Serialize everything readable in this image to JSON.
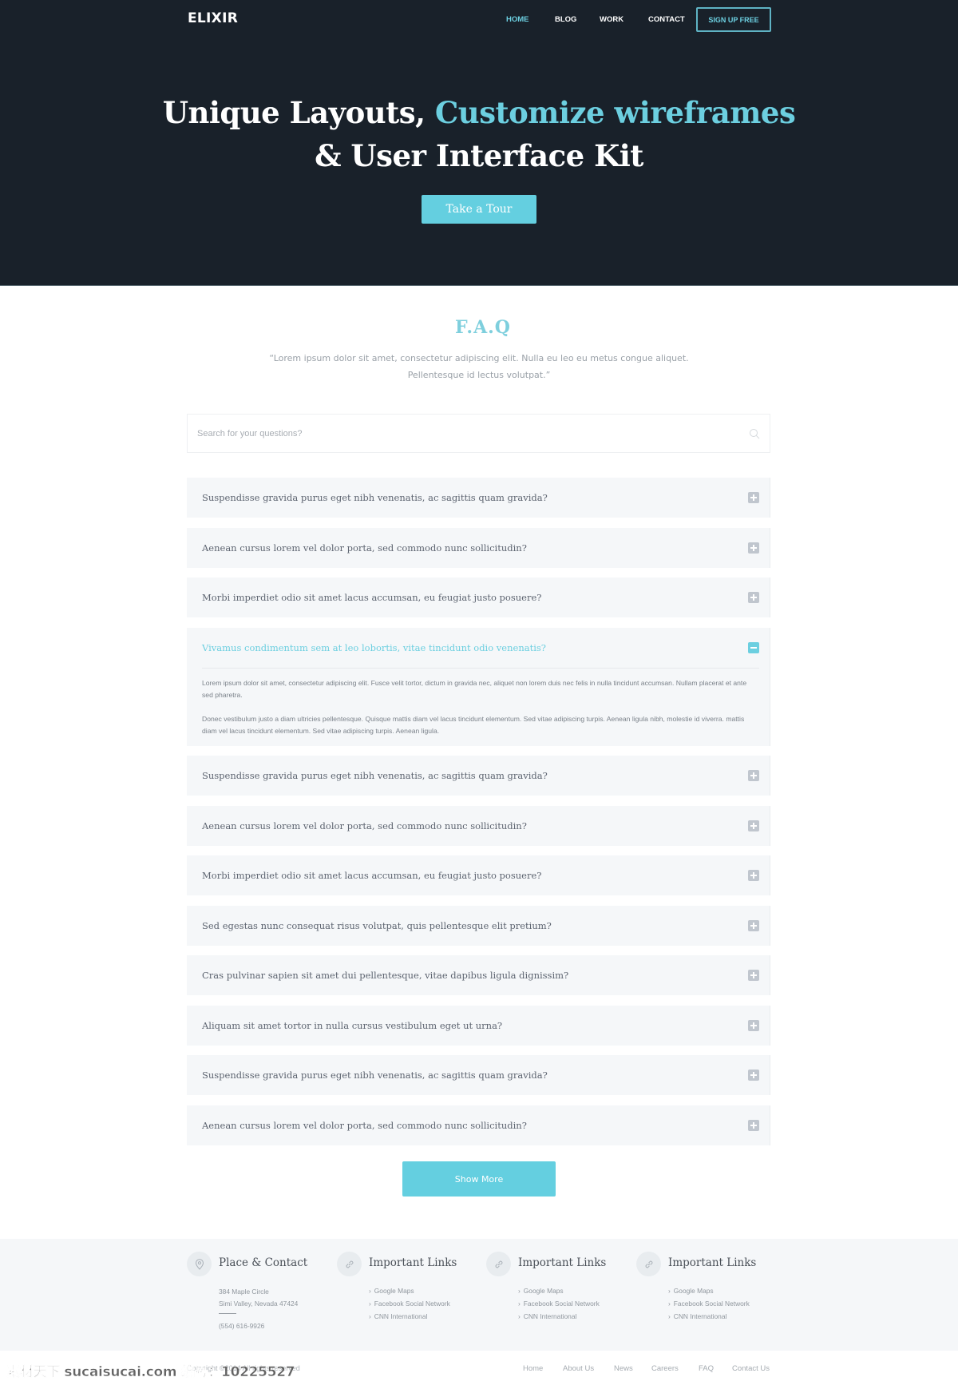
{
  "header": {
    "logo": "ELIXIR",
    "nav": [
      {
        "label": "HOME",
        "active": true
      },
      {
        "label": "BLOG",
        "active": false
      },
      {
        "label": "WORK",
        "active": false
      },
      {
        "label": "CONTACT",
        "active": false
      }
    ],
    "signup_label": "SIGN UP FREE"
  },
  "hero": {
    "title_part1": "Unique Layouts, ",
    "title_accent": "Customize wireframes",
    "title_line2": "& User Interface Kit",
    "cta_label": "Take a Tour"
  },
  "faq": {
    "title": "F.A.Q",
    "subtitle_line1": "“Lorem ipsum dolor sit amet, consectetur adipiscing elit. Nulla eu leo eu metus congue aliquet.",
    "subtitle_line2": "Pellentesque id lectus volutpat.”",
    "search_placeholder": "Search for your questions?",
    "search_icon": "search-icon",
    "items": [
      {
        "question": "Suspendisse gravida purus eget nibh venenatis, ac sagittis quam gravida?",
        "expanded": false
      },
      {
        "question": "Aenean cursus lorem vel dolor porta, sed commodo nunc sollicitudin?",
        "expanded": false
      },
      {
        "question": "Morbi imperdiet odio sit amet lacus accumsan, eu feugiat justo posuere?",
        "expanded": false
      },
      {
        "question": "Vivamus condimentum sem at leo lobortis, vitae tincidunt odio venenatis?",
        "expanded": true,
        "answer": [
          "Lorem ipsum dolor sit amet, consectetur adipiscing elit. Fusce velit tortor, dictum in gravida nec, aliquet non lorem duis nec felis in nulla tincidunt accumsan. Nullam placerat et ante sed pharetra.",
          "Donec vestibulum justo a diam ultricies pellentesque. Quisque mattis diam vel lacus tincidunt elementum. Sed vitae adipiscing turpis. Aenean ligula nibh, molestie id viverra. mattis diam vel lacus tincidunt elementum. Sed vitae adipiscing turpis. Aenean ligula."
        ]
      },
      {
        "question": "Suspendisse gravida purus eget nibh venenatis, ac sagittis quam gravida?",
        "expanded": false
      },
      {
        "question": "Aenean cursus lorem vel dolor porta, sed commodo nunc sollicitudin?",
        "expanded": false
      },
      {
        "question": "Morbi imperdiet odio sit amet lacus accumsan, eu feugiat justo posuere?",
        "expanded": false
      },
      {
        "question": "Sed egestas nunc consequat risus volutpat, quis pellentesque elit pretium?",
        "expanded": false
      },
      {
        "question": "Cras pulvinar sapien sit amet dui pellentesque, vitae dapibus ligula dignissim?",
        "expanded": false
      },
      {
        "question": "Aliquam sit amet tortor in nulla cursus vestibulum eget ut urna?",
        "expanded": false
      },
      {
        "question": "Suspendisse gravida purus eget nibh venenatis, ac sagittis quam gravida?",
        "expanded": false
      },
      {
        "question": "Aenean cursus lorem vel dolor porta, sed commodo nunc sollicitudin?",
        "expanded": false
      }
    ],
    "show_more_label": "Show More"
  },
  "footer": {
    "contact": {
      "icon": "map-pin-icon",
      "title": "Place & Contact",
      "address_line1": "384 Maple Circle",
      "address_line2": "Simi Valley, Nevada 47424",
      "phone": "(554) 616-9926"
    },
    "link_columns": [
      {
        "icon": "link-icon",
        "title": "Important Links",
        "links": [
          "Google Maps",
          "Facebook Social Network",
          "CNN International"
        ]
      },
      {
        "icon": "link-icon",
        "title": "Important Links",
        "links": [
          "Google Maps",
          "Facebook Social Network",
          "CNN International"
        ]
      },
      {
        "icon": "link-icon",
        "title": "Important Links",
        "links": [
          "Google Maps",
          "Facebook Social Network",
          "CNN International"
        ]
      }
    ],
    "copyright": "Copyright ©2014 All rights reserved",
    "bottom_links": [
      "Home",
      "About Us",
      "News",
      "Careers",
      "FAQ",
      "Contact Us"
    ]
  },
  "watermark": "素材天下 sucaisucai.com  编号：10225527",
  "colors": {
    "hero_bg": "#19212a",
    "accent": "#64cfe0",
    "item_bg": "#f5f7f9",
    "toggle_inactive": "#c0c6ce"
  }
}
